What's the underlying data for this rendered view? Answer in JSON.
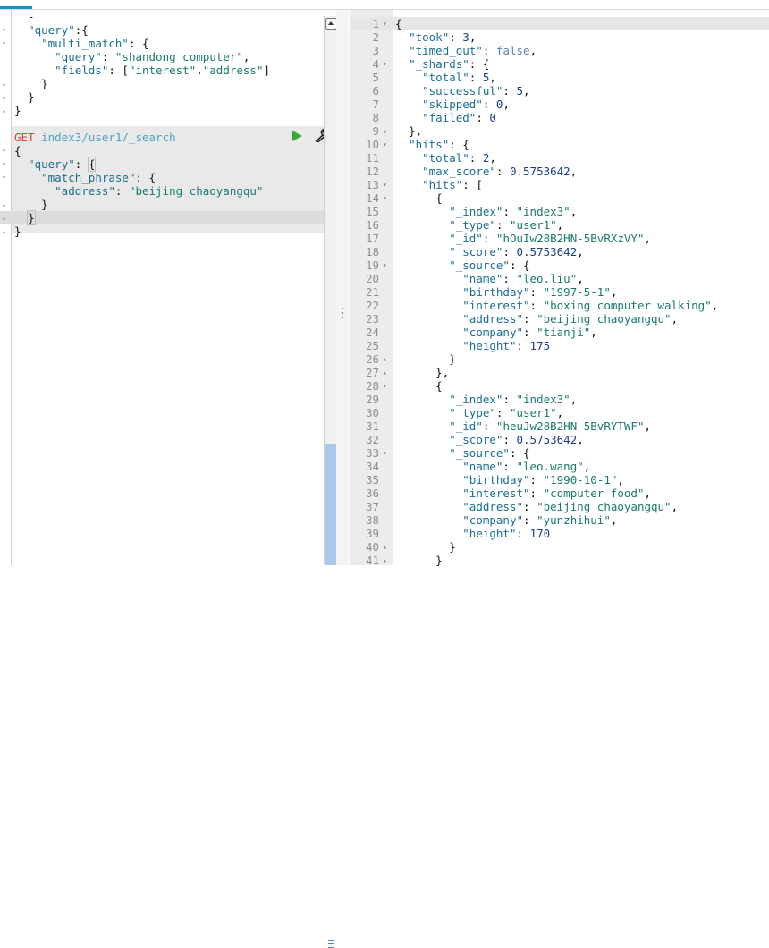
{
  "request_editor": {
    "lines": [
      {
        "fold": "",
        "parts": [
          {
            "t": "  -",
            "c": "p"
          }
        ]
      },
      {
        "fold": "▾",
        "parts": [
          {
            "t": "  ",
            "c": "p"
          },
          {
            "t": "\"query\"",
            "c": "k"
          },
          {
            "t": ":{",
            "c": "p"
          }
        ]
      },
      {
        "fold": "▾",
        "parts": [
          {
            "t": "    ",
            "c": "p"
          },
          {
            "t": "\"multi_match\"",
            "c": "k"
          },
          {
            "t": ": {",
            "c": "p"
          }
        ]
      },
      {
        "fold": "",
        "parts": [
          {
            "t": "      ",
            "c": "p"
          },
          {
            "t": "\"query\"",
            "c": "k"
          },
          {
            "t": ": ",
            "c": "p"
          },
          {
            "t": "\"shandong computer\"",
            "c": "s"
          },
          {
            "t": ",",
            "c": "p"
          }
        ]
      },
      {
        "fold": "",
        "parts": [
          {
            "t": "      ",
            "c": "p"
          },
          {
            "t": "\"fields\"",
            "c": "k"
          },
          {
            "t": ": [",
            "c": "p"
          },
          {
            "t": "\"interest\"",
            "c": "s"
          },
          {
            "t": ",",
            "c": "p"
          },
          {
            "t": "\"address\"",
            "c": "s"
          },
          {
            "t": "]",
            "c": "p"
          }
        ]
      },
      {
        "fold": "▴",
        "parts": [
          {
            "t": "    }",
            "c": "p"
          }
        ]
      },
      {
        "fold": "▴",
        "parts": [
          {
            "t": "  }",
            "c": "p"
          }
        ]
      },
      {
        "fold": "▴",
        "parts": [
          {
            "t": "}",
            "c": "p"
          }
        ]
      },
      {
        "fold": "",
        "parts": []
      },
      {
        "fold": "",
        "parts": [
          {
            "t": "GET",
            "c": "get"
          },
          {
            "t": " ",
            "c": "p"
          },
          {
            "t": "index3/user1/_search",
            "c": "url"
          }
        ]
      },
      {
        "fold": "▾",
        "parts": [
          {
            "t": "{",
            "c": "p"
          }
        ]
      },
      {
        "fold": "▾",
        "parts": [
          {
            "t": "  ",
            "c": "p"
          },
          {
            "t": "\"query\"",
            "c": "k"
          },
          {
            "t": ": ",
            "c": "p"
          },
          {
            "t": "{",
            "c": "p br"
          }
        ]
      },
      {
        "fold": "▾",
        "parts": [
          {
            "t": "    ",
            "c": "p"
          },
          {
            "t": "\"match_phrase\"",
            "c": "k"
          },
          {
            "t": ": {",
            "c": "p"
          }
        ]
      },
      {
        "fold": "",
        "parts": [
          {
            "t": "      ",
            "c": "p"
          },
          {
            "t": "\"address\"",
            "c": "k"
          },
          {
            "t": ": ",
            "c": "p"
          },
          {
            "t": "\"beijing chaoyangqu\"",
            "c": "s"
          }
        ]
      },
      {
        "fold": "▴",
        "parts": [
          {
            "t": "    }",
            "c": "p"
          }
        ]
      },
      {
        "fold": "▴",
        "parts": [
          {
            "t": "  ",
            "c": "p"
          },
          {
            "t": "}",
            "c": "p br"
          },
          {
            "t": "|",
            "c": "caret"
          }
        ]
      },
      {
        "fold": "▴",
        "parts": [
          {
            "t": "}",
            "c": "p"
          }
        ]
      }
    ],
    "highlight_from": 9,
    "highlight_to": 16,
    "cursor_line": 15
  },
  "response": {
    "lines": [
      {
        "n": "1",
        "fold": "▾",
        "parts": [
          {
            "t": "{",
            "c": "p"
          }
        ]
      },
      {
        "n": "2",
        "fold": "",
        "parts": [
          {
            "t": "  ",
            "c": "p"
          },
          {
            "t": "\"took\"",
            "c": "k"
          },
          {
            "t": ": ",
            "c": "p"
          },
          {
            "t": "3",
            "c": "n"
          },
          {
            "t": ",",
            "c": "p"
          }
        ]
      },
      {
        "n": "3",
        "fold": "",
        "parts": [
          {
            "t": "  ",
            "c": "p"
          },
          {
            "t": "\"timed_out\"",
            "c": "k"
          },
          {
            "t": ": ",
            "c": "p"
          },
          {
            "t": "false",
            "c": "kw"
          },
          {
            "t": ",",
            "c": "p"
          }
        ]
      },
      {
        "n": "4",
        "fold": "▾",
        "parts": [
          {
            "t": "  ",
            "c": "p"
          },
          {
            "t": "\"_shards\"",
            "c": "k"
          },
          {
            "t": ": {",
            "c": "p"
          }
        ]
      },
      {
        "n": "5",
        "fold": "",
        "parts": [
          {
            "t": "    ",
            "c": "p"
          },
          {
            "t": "\"total\"",
            "c": "k"
          },
          {
            "t": ": ",
            "c": "p"
          },
          {
            "t": "5",
            "c": "n"
          },
          {
            "t": ",",
            "c": "p"
          }
        ]
      },
      {
        "n": "6",
        "fold": "",
        "parts": [
          {
            "t": "    ",
            "c": "p"
          },
          {
            "t": "\"successful\"",
            "c": "k"
          },
          {
            "t": ": ",
            "c": "p"
          },
          {
            "t": "5",
            "c": "n"
          },
          {
            "t": ",",
            "c": "p"
          }
        ]
      },
      {
        "n": "7",
        "fold": "",
        "parts": [
          {
            "t": "    ",
            "c": "p"
          },
          {
            "t": "\"skipped\"",
            "c": "k"
          },
          {
            "t": ": ",
            "c": "p"
          },
          {
            "t": "0",
            "c": "n"
          },
          {
            "t": ",",
            "c": "p"
          }
        ]
      },
      {
        "n": "8",
        "fold": "",
        "parts": [
          {
            "t": "    ",
            "c": "p"
          },
          {
            "t": "\"failed\"",
            "c": "k"
          },
          {
            "t": ": ",
            "c": "p"
          },
          {
            "t": "0",
            "c": "n"
          }
        ]
      },
      {
        "n": "9",
        "fold": "▴",
        "parts": [
          {
            "t": "  },",
            "c": "p"
          }
        ]
      },
      {
        "n": "10",
        "fold": "▾",
        "parts": [
          {
            "t": "  ",
            "c": "p"
          },
          {
            "t": "\"hits\"",
            "c": "k"
          },
          {
            "t": ": {",
            "c": "p"
          }
        ]
      },
      {
        "n": "11",
        "fold": "",
        "parts": [
          {
            "t": "    ",
            "c": "p"
          },
          {
            "t": "\"total\"",
            "c": "k"
          },
          {
            "t": ": ",
            "c": "p"
          },
          {
            "t": "2",
            "c": "n"
          },
          {
            "t": ",",
            "c": "p"
          }
        ]
      },
      {
        "n": "12",
        "fold": "",
        "parts": [
          {
            "t": "    ",
            "c": "p"
          },
          {
            "t": "\"max_score\"",
            "c": "k"
          },
          {
            "t": ": ",
            "c": "p"
          },
          {
            "t": "0.5753642",
            "c": "n"
          },
          {
            "t": ",",
            "c": "p"
          }
        ]
      },
      {
        "n": "13",
        "fold": "▾",
        "parts": [
          {
            "t": "    ",
            "c": "p"
          },
          {
            "t": "\"hits\"",
            "c": "k"
          },
          {
            "t": ": [",
            "c": "p"
          }
        ]
      },
      {
        "n": "14",
        "fold": "▾",
        "parts": [
          {
            "t": "      {",
            "c": "p"
          }
        ]
      },
      {
        "n": "15",
        "fold": "",
        "parts": [
          {
            "t": "        ",
            "c": "p"
          },
          {
            "t": "\"_index\"",
            "c": "k"
          },
          {
            "t": ": ",
            "c": "p"
          },
          {
            "t": "\"index3\"",
            "c": "s"
          },
          {
            "t": ",",
            "c": "p"
          }
        ]
      },
      {
        "n": "16",
        "fold": "",
        "parts": [
          {
            "t": "        ",
            "c": "p"
          },
          {
            "t": "\"_type\"",
            "c": "k"
          },
          {
            "t": ": ",
            "c": "p"
          },
          {
            "t": "\"user1\"",
            "c": "s"
          },
          {
            "t": ",",
            "c": "p"
          }
        ]
      },
      {
        "n": "17",
        "fold": "",
        "parts": [
          {
            "t": "        ",
            "c": "p"
          },
          {
            "t": "\"_id\"",
            "c": "k"
          },
          {
            "t": ": ",
            "c": "p"
          },
          {
            "t": "\"hOuIw28B2HN-5BvRXzVY\"",
            "c": "s"
          },
          {
            "t": ",",
            "c": "p"
          }
        ]
      },
      {
        "n": "18",
        "fold": "",
        "parts": [
          {
            "t": "        ",
            "c": "p"
          },
          {
            "t": "\"_score\"",
            "c": "k"
          },
          {
            "t": ": ",
            "c": "p"
          },
          {
            "t": "0.5753642",
            "c": "n"
          },
          {
            "t": ",",
            "c": "p"
          }
        ]
      },
      {
        "n": "19",
        "fold": "▾",
        "parts": [
          {
            "t": "        ",
            "c": "p"
          },
          {
            "t": "\"_source\"",
            "c": "k"
          },
          {
            "t": ": {",
            "c": "p"
          }
        ]
      },
      {
        "n": "20",
        "fold": "",
        "parts": [
          {
            "t": "          ",
            "c": "p"
          },
          {
            "t": "\"name\"",
            "c": "k"
          },
          {
            "t": ": ",
            "c": "p"
          },
          {
            "t": "\"leo.liu\"",
            "c": "s"
          },
          {
            "t": ",",
            "c": "p"
          }
        ]
      },
      {
        "n": "21",
        "fold": "",
        "parts": [
          {
            "t": "          ",
            "c": "p"
          },
          {
            "t": "\"birthday\"",
            "c": "k"
          },
          {
            "t": ": ",
            "c": "p"
          },
          {
            "t": "\"1997-5-1\"",
            "c": "s"
          },
          {
            "t": ",",
            "c": "p"
          }
        ]
      },
      {
        "n": "22",
        "fold": "",
        "parts": [
          {
            "t": "          ",
            "c": "p"
          },
          {
            "t": "\"interest\"",
            "c": "k"
          },
          {
            "t": ": ",
            "c": "p"
          },
          {
            "t": "\"boxing computer walking\"",
            "c": "s"
          },
          {
            "t": ",",
            "c": "p"
          }
        ]
      },
      {
        "n": "23",
        "fold": "",
        "parts": [
          {
            "t": "          ",
            "c": "p"
          },
          {
            "t": "\"address\"",
            "c": "k"
          },
          {
            "t": ": ",
            "c": "p"
          },
          {
            "t": "\"beijing chaoyangqu\"",
            "c": "s"
          },
          {
            "t": ",",
            "c": "p"
          }
        ]
      },
      {
        "n": "24",
        "fold": "",
        "parts": [
          {
            "t": "          ",
            "c": "p"
          },
          {
            "t": "\"company\"",
            "c": "k"
          },
          {
            "t": ": ",
            "c": "p"
          },
          {
            "t": "\"tianji\"",
            "c": "s"
          },
          {
            "t": ",",
            "c": "p"
          }
        ]
      },
      {
        "n": "25",
        "fold": "",
        "parts": [
          {
            "t": "          ",
            "c": "p"
          },
          {
            "t": "\"height\"",
            "c": "k"
          },
          {
            "t": ": ",
            "c": "p"
          },
          {
            "t": "175",
            "c": "n"
          }
        ]
      },
      {
        "n": "26",
        "fold": "▴",
        "parts": [
          {
            "t": "        }",
            "c": "p"
          }
        ]
      },
      {
        "n": "27",
        "fold": "▴",
        "parts": [
          {
            "t": "      },",
            "c": "p"
          }
        ]
      },
      {
        "n": "28",
        "fold": "▾",
        "parts": [
          {
            "t": "      {",
            "c": "p"
          }
        ]
      },
      {
        "n": "29",
        "fold": "",
        "parts": [
          {
            "t": "        ",
            "c": "p"
          },
          {
            "t": "\"_index\"",
            "c": "k"
          },
          {
            "t": ": ",
            "c": "p"
          },
          {
            "t": "\"index3\"",
            "c": "s"
          },
          {
            "t": ",",
            "c": "p"
          }
        ]
      },
      {
        "n": "30",
        "fold": "",
        "parts": [
          {
            "t": "        ",
            "c": "p"
          },
          {
            "t": "\"_type\"",
            "c": "k"
          },
          {
            "t": ": ",
            "c": "p"
          },
          {
            "t": "\"user1\"",
            "c": "s"
          },
          {
            "t": ",",
            "c": "p"
          }
        ]
      },
      {
        "n": "31",
        "fold": "",
        "parts": [
          {
            "t": "        ",
            "c": "p"
          },
          {
            "t": "\"_id\"",
            "c": "k"
          },
          {
            "t": ": ",
            "c": "p"
          },
          {
            "t": "\"heuJw28B2HN-5BvRYTWF\"",
            "c": "s"
          },
          {
            "t": ",",
            "c": "p"
          }
        ]
      },
      {
        "n": "32",
        "fold": "",
        "parts": [
          {
            "t": "        ",
            "c": "p"
          },
          {
            "t": "\"_score\"",
            "c": "k"
          },
          {
            "t": ": ",
            "c": "p"
          },
          {
            "t": "0.5753642",
            "c": "n"
          },
          {
            "t": ",",
            "c": "p"
          }
        ]
      },
      {
        "n": "33",
        "fold": "▾",
        "parts": [
          {
            "t": "        ",
            "c": "p"
          },
          {
            "t": "\"_source\"",
            "c": "k"
          },
          {
            "t": ": {",
            "c": "p"
          }
        ]
      },
      {
        "n": "34",
        "fold": "",
        "parts": [
          {
            "t": "          ",
            "c": "p"
          },
          {
            "t": "\"name\"",
            "c": "k"
          },
          {
            "t": ": ",
            "c": "p"
          },
          {
            "t": "\"leo.wang\"",
            "c": "s"
          },
          {
            "t": ",",
            "c": "p"
          }
        ]
      },
      {
        "n": "35",
        "fold": "",
        "parts": [
          {
            "t": "          ",
            "c": "p"
          },
          {
            "t": "\"birthday\"",
            "c": "k"
          },
          {
            "t": ": ",
            "c": "p"
          },
          {
            "t": "\"1990-10-1\"",
            "c": "s"
          },
          {
            "t": ",",
            "c": "p"
          }
        ]
      },
      {
        "n": "36",
        "fold": "",
        "parts": [
          {
            "t": "          ",
            "c": "p"
          },
          {
            "t": "\"interest\"",
            "c": "k"
          },
          {
            "t": ": ",
            "c": "p"
          },
          {
            "t": "\"computer food\"",
            "c": "s"
          },
          {
            "t": ",",
            "c": "p"
          }
        ]
      },
      {
        "n": "37",
        "fold": "",
        "parts": [
          {
            "t": "          ",
            "c": "p"
          },
          {
            "t": "\"address\"",
            "c": "k"
          },
          {
            "t": ": ",
            "c": "p"
          },
          {
            "t": "\"beijing chaoyangqu\"",
            "c": "s"
          },
          {
            "t": ",",
            "c": "p"
          }
        ]
      },
      {
        "n": "38",
        "fold": "",
        "parts": [
          {
            "t": "          ",
            "c": "p"
          },
          {
            "t": "\"company\"",
            "c": "k"
          },
          {
            "t": ": ",
            "c": "p"
          },
          {
            "t": "\"yunzhihui\"",
            "c": "s"
          },
          {
            "t": ",",
            "c": "p"
          }
        ]
      },
      {
        "n": "39",
        "fold": "",
        "parts": [
          {
            "t": "          ",
            "c": "p"
          },
          {
            "t": "\"height\"",
            "c": "k"
          },
          {
            "t": ": ",
            "c": "p"
          },
          {
            "t": "170",
            "c": "n"
          }
        ]
      },
      {
        "n": "40",
        "fold": "▴",
        "parts": [
          {
            "t": "        }",
            "c": "p"
          }
        ]
      },
      {
        "n": "41",
        "fold": "▴",
        "parts": [
          {
            "t": "      }",
            "c": "p"
          }
        ]
      }
    ],
    "cursor_line": 0
  },
  "icons": {
    "run": "play-icon",
    "settings": "wrench-icon",
    "scroll_up": "chevron-up-icon",
    "drag": "grip-icon"
  },
  "colors": {
    "key": "#1a6e92",
    "string": "#1a7a6e",
    "number": "#1a3d8c",
    "method_get": "#e53b3b",
    "url": "#4aa3c8",
    "run_green": "#3aaa35",
    "scroll_thumb": "#a9c8ec"
  }
}
